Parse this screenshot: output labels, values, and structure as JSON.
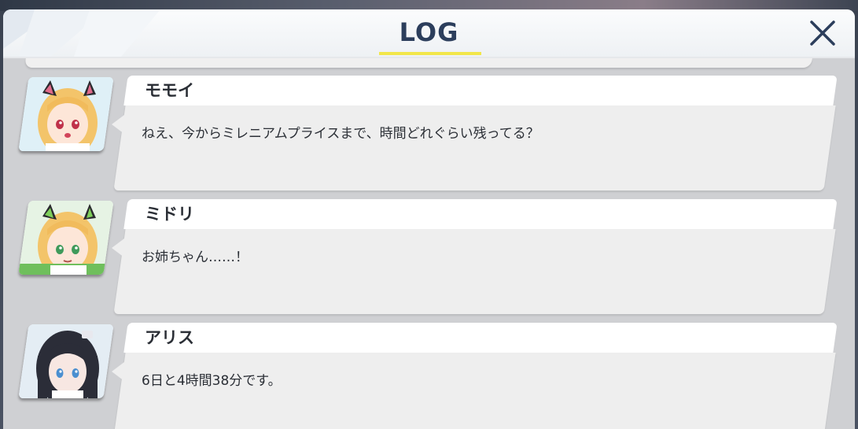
{
  "header": {
    "title": "LOG",
    "close_icon": "close-icon",
    "accent_color": "#f2e64a",
    "title_color": "#2c3e5c"
  },
  "log": {
    "entries": [
      {
        "speaker": "モモイ",
        "text": "ねえ、今からミレニアムプライスまで、時間どれぐらい残ってる？",
        "avatar": "momoi-avatar"
      },
      {
        "speaker": "ミドリ",
        "text": "お姉ちゃん……！",
        "avatar": "midori-avatar"
      },
      {
        "speaker": "アリス",
        "text": "6日と4時間38分です。",
        "avatar": "aris-avatar"
      }
    ]
  }
}
